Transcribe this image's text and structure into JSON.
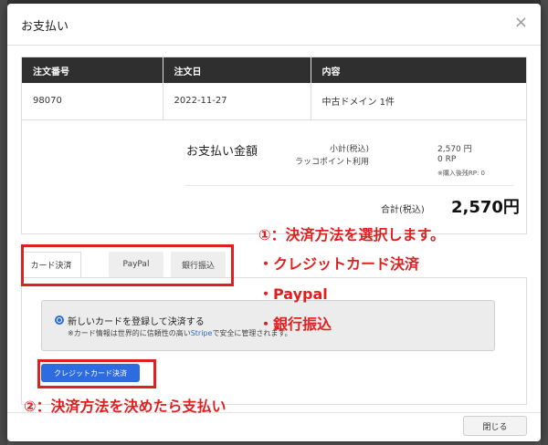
{
  "modal": {
    "title": "お支払い",
    "close_glyph": "×"
  },
  "order_table": {
    "headers": [
      "注文番号",
      "注文日",
      "内容"
    ],
    "row": [
      "98070",
      "2022-11-27",
      "中古ドメイン 1件"
    ]
  },
  "amount": {
    "title": "お支払い金額",
    "subtotal_label": "小計(税込)",
    "subtotal_value": "2,570 円",
    "points_label": "ラッコポイント利用",
    "points_value": "0 RP",
    "rp_note": "※購入後残RP: 0",
    "total_label": "合計(税込)",
    "total_value": "2,570円"
  },
  "tabs": [
    "カード決済",
    "PayPal",
    "銀行振込"
  ],
  "card_option": {
    "label": "新しいカードを登録して決済する",
    "note_prefix": "※カード情報は世界的に信頼性の高い",
    "note_stripe": "Stripe",
    "note_suffix": "で安全に管理されます。"
  },
  "pay_button": "クレジットカード決済",
  "close_button": "閉じる",
  "annotations": {
    "a1": "①：決済方法を選択します。",
    "a2": "・クレジットカード決済",
    "a3": "・Paypal",
    "a4": "・銀行振込",
    "a5": "②：決済方法を決めたら支払い"
  },
  "colors": {
    "accent": "#2d6ce0",
    "annotation": "#e02020",
    "table_header": "#2f2f2f"
  }
}
